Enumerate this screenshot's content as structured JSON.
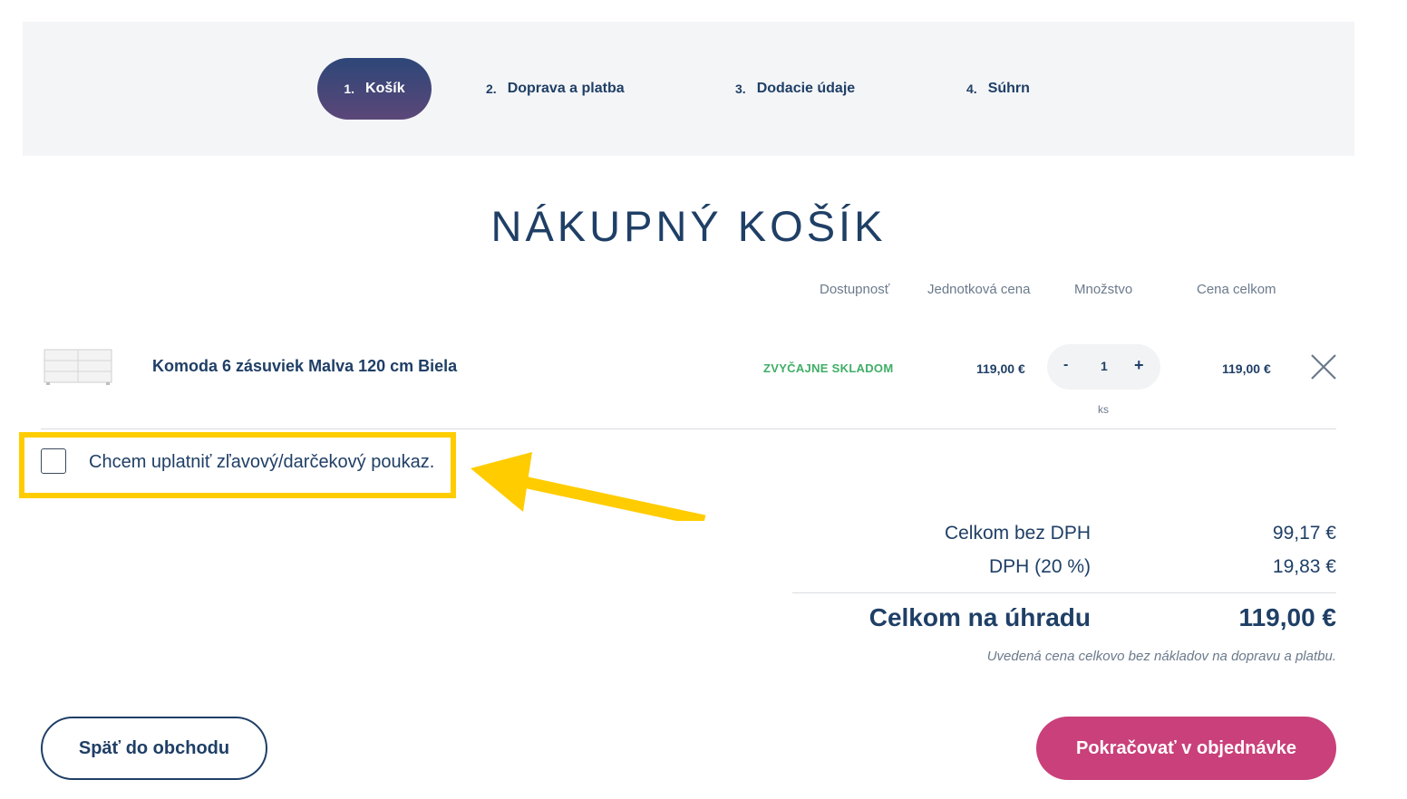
{
  "steps": [
    {
      "num": "1.",
      "label": "Košík"
    },
    {
      "num": "2.",
      "label": "Doprava a platba"
    },
    {
      "num": "3.",
      "label": "Dodacie údaje"
    },
    {
      "num": "4.",
      "label": "Súhrn"
    }
  ],
  "page_title": "NÁKUPNÝ KOŠÍK",
  "columns": {
    "availability": "Dostupnosť",
    "unit_price": "Jednotková cena",
    "quantity": "Množstvo",
    "total": "Cena celkom"
  },
  "cart_item": {
    "name": "Komoda 6 zásuviek Malva 120 cm Biela",
    "availability": "ZVYČAJNE SKLADOM",
    "unit_price": "119,00 €",
    "qty_minus": "-",
    "quantity": "1",
    "qty_plus": "+",
    "qty_unit": "ks",
    "line_total": "119,00 €"
  },
  "voucher": {
    "label": "Chcem uplatniť zľavový/darčekový poukaz."
  },
  "summary": {
    "without_vat_label": "Celkom bez DPH",
    "without_vat_value": "99,17 €",
    "vat_label": "DPH (20 %)",
    "vat_value": "19,83 €",
    "total_label": "Celkom na úhradu",
    "total_value": "119,00 €",
    "note": "Uvedená cena celkovo bez nákladov na dopravu a platbu."
  },
  "buttons": {
    "back": "Späť do obchodu",
    "continue": "Pokračovať v objednávke"
  },
  "colors": {
    "primary": "#1f3f66",
    "accent": "#c9407a",
    "in_stock": "#3fae66",
    "highlight": "#ffcc00"
  }
}
